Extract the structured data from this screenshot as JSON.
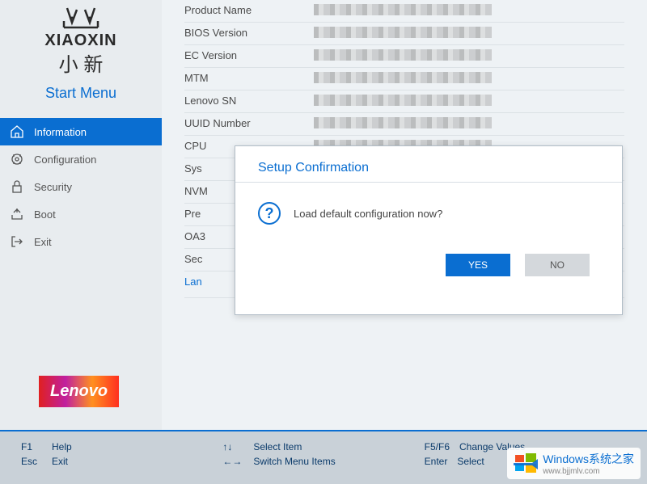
{
  "brand": {
    "xiaoxin_en": "XIAOXIN",
    "xiaoxin_cn": "小 新",
    "start_menu": "Start Menu",
    "lenovo": "Lenovo"
  },
  "nav": [
    {
      "label": "Information",
      "icon": "home"
    },
    {
      "label": "Configuration",
      "icon": "config"
    },
    {
      "label": "Security",
      "icon": "lock"
    },
    {
      "label": "Boot",
      "icon": "boot"
    },
    {
      "label": "Exit",
      "icon": "exit"
    }
  ],
  "info": {
    "rows": [
      {
        "label": "Product Name"
      },
      {
        "label": "BIOS Version"
      },
      {
        "label": "EC Version"
      },
      {
        "label": "MTM"
      },
      {
        "label": "Lenovo SN"
      },
      {
        "label": "UUID Number"
      },
      {
        "label": "CPU"
      },
      {
        "label": "Sys"
      },
      {
        "label": "NVM"
      },
      {
        "label": "Pre"
      },
      {
        "label": "OA3"
      },
      {
        "label": "Sec"
      },
      {
        "label": "Lan"
      }
    ]
  },
  "dialog": {
    "title": "Setup Confirmation",
    "message": "Load default configuration now?",
    "yes": "YES",
    "no": "NO"
  },
  "footer": {
    "col1": [
      {
        "key": "F1",
        "action": "Help"
      },
      {
        "key": "Esc",
        "action": "Exit"
      }
    ],
    "col2": [
      {
        "key": "↑↓",
        "action": "Select Item"
      },
      {
        "key": "←→",
        "action": "Switch Menu Items"
      }
    ],
    "col3": [
      {
        "key": "F5/F6",
        "action": "Change Values"
      },
      {
        "key": "Enter",
        "action": "Select"
      }
    ]
  },
  "watermark": {
    "text": "Windows系统之家",
    "url": "www.bjjmlv.com"
  }
}
